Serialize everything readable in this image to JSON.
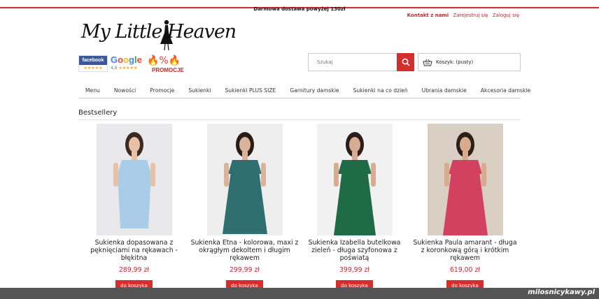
{
  "top_bar": {
    "announcement": "Darmowa dostawa powyżej 130zł"
  },
  "account": {
    "contact": "Kontakt z nami",
    "register": "Zarejestruj się",
    "login": "Zaloguj się"
  },
  "logo": {
    "text": "My Little Heaven"
  },
  "badges": {
    "facebook": {
      "label": "facebook",
      "stars": "★★★★★"
    },
    "google": {
      "label": "Google",
      "rating": "4,8",
      "stars": "★★★★★"
    },
    "promo": {
      "icons": "🔥%🔥",
      "label": "PROMOCJE"
    }
  },
  "search": {
    "placeholder": "Szukaj",
    "value": ""
  },
  "cart": {
    "label": "Koszyk:",
    "status": "(pusty)"
  },
  "nav": {
    "items": [
      {
        "label": "Menu"
      },
      {
        "label": "Nowości"
      },
      {
        "label": "Promocje"
      },
      {
        "label": "Sukienki"
      },
      {
        "label": "Sukienki PLUS SIZE"
      },
      {
        "label": "Garnitury damskie"
      },
      {
        "label": "Sukienki na co dzień"
      },
      {
        "label": "Ubrania damskie"
      },
      {
        "label": "Akcesoria damskie"
      }
    ]
  },
  "bestsellers": {
    "title": "Bestsellery",
    "products": [
      {
        "name": "Sukienka dopasowana z pęknięciami na rękawach - błękitna",
        "price": "289,99 zł",
        "cta": "do koszyka",
        "bg": "#e9e8ea",
        "dress": "#a9cde9",
        "skin": "#e8c1a6",
        "hair": "#3a2a22"
      },
      {
        "name": "Sukienka Etna - kolorowa, maxi z okrągłym dekoltem i długim rękawem",
        "price": "299,99 zł",
        "cta": "do koszyka",
        "bg": "#eeeeee",
        "dress": "#2f6f70",
        "skin": "#d9b49a",
        "hair": "#2a1d18"
      },
      {
        "name": "Sukienka Izabella butelkowa zieleń - długa szyfonowa z poświatą",
        "price": "399,99 zł",
        "cta": "do koszyka",
        "bg": "#f1f1f1",
        "dress": "#1f6b45",
        "skin": "#d6ad92",
        "hair": "#2b1e19"
      },
      {
        "name": "Sukienka Paula amarant - długa z koronkową górą i krótkim rękawem",
        "price": "619,00 zł",
        "cta": "do koszyka",
        "bg": "#d9cfc3",
        "dress": "#d2415f",
        "skin": "#d8ab8f",
        "hair": "#2c1f1a"
      }
    ]
  },
  "watermark": {
    "text": "milosnicykawy.pl"
  }
}
